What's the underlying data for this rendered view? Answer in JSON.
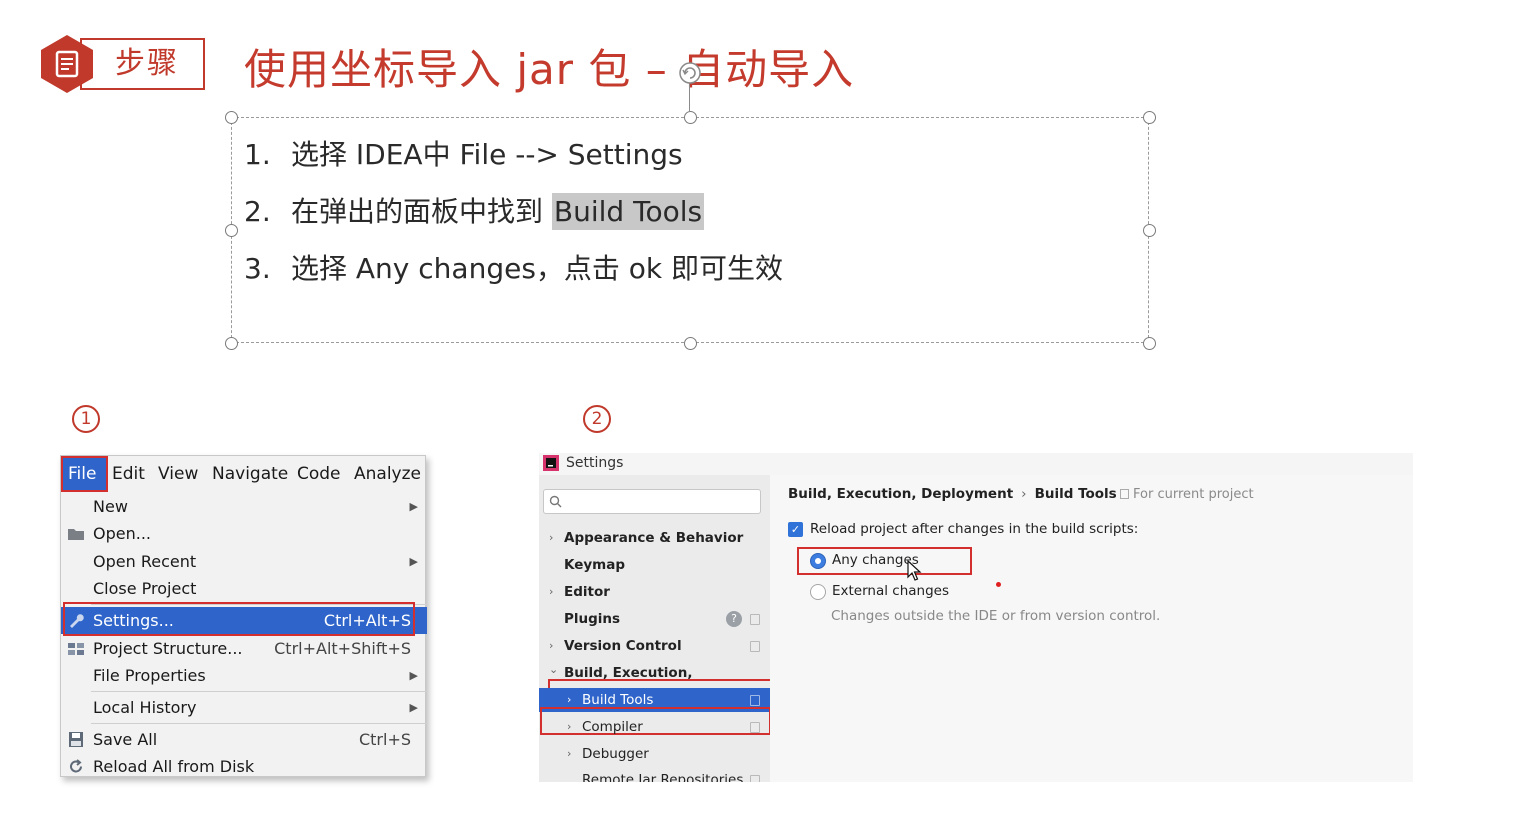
{
  "header": {
    "step_label": "步骤",
    "title": "使用坐标导入 jar 包 – 自动导入"
  },
  "steps": [
    {
      "num": "1.",
      "text": "选择 IDEA中 File --> Settings"
    },
    {
      "num": "2.",
      "text": "在弹出的面板中找到 ",
      "highlight": "Build Tools"
    },
    {
      "num": "3.",
      "text": "选择 Any changes，点击 ok 即可生效"
    }
  ],
  "markers": {
    "one": "①",
    "two": "②"
  },
  "file_menu": {
    "menubar": [
      "File",
      "Edit",
      "View",
      "Navigate",
      "Code",
      "Analyze"
    ],
    "items": [
      {
        "label": "New",
        "shortcut": "",
        "submenu": true
      },
      {
        "label": "Open...",
        "shortcut": "",
        "submenu": false,
        "icon": "folder-icon"
      },
      {
        "label": "Open Recent",
        "shortcut": "",
        "submenu": true
      },
      {
        "label": "Close Project",
        "shortcut": "",
        "submenu": false
      },
      {
        "label": "Settings...",
        "shortcut": "Ctrl+Alt+S",
        "submenu": false,
        "icon": "wrench-icon",
        "selected": true
      },
      {
        "label": "Project Structure...",
        "shortcut": "Ctrl+Alt+Shift+S",
        "submenu": false,
        "icon": "project-structure-icon"
      },
      {
        "label": "File Properties",
        "shortcut": "",
        "submenu": true
      },
      {
        "label": "Local History",
        "shortcut": "",
        "submenu": true
      },
      {
        "label": "Save All",
        "shortcut": "Ctrl+S",
        "submenu": false,
        "icon": "save-icon"
      },
      {
        "label": "Reload All from Disk",
        "shortcut": "",
        "submenu": false,
        "icon": "reload-icon"
      }
    ]
  },
  "settings": {
    "title": "Settings",
    "search_placeholder": "",
    "tree": [
      {
        "label": "Appearance & Behavior",
        "chevron": "›",
        "bold": true
      },
      {
        "label": "Keymap",
        "chevron": "",
        "bold": true
      },
      {
        "label": "Editor",
        "chevron": "›",
        "bold": true
      },
      {
        "label": "Plugins",
        "chevron": "",
        "bold": true
      },
      {
        "label": "Version Control",
        "chevron": "›",
        "bold": true
      },
      {
        "label": "Build, Execution, Deployment",
        "chevron": "⌄",
        "bold": true
      },
      {
        "label": "Build Tools",
        "chevron": "›",
        "bold": false,
        "selected": true
      },
      {
        "label": "Compiler",
        "chevron": "›",
        "bold": false
      },
      {
        "label": "Debugger",
        "chevron": "›",
        "bold": false
      },
      {
        "label": "Remote Jar Repositories",
        "chevron": "",
        "bold": false
      }
    ],
    "breadcrumb": [
      "Build, Execution, Deployment",
      "Build Tools"
    ],
    "for_current_project": "For current project",
    "reload_label": "Reload project after changes in the build scripts:",
    "options": [
      {
        "label": "Any changes",
        "selected": true
      },
      {
        "label": "External changes",
        "selected": false
      }
    ],
    "external_desc": "Changes outside the IDE or from version control.",
    "colors": {
      "accent": "#2f65ca",
      "highlight_box": "#d32f2f",
      "title_red": "#c43b2d"
    }
  }
}
